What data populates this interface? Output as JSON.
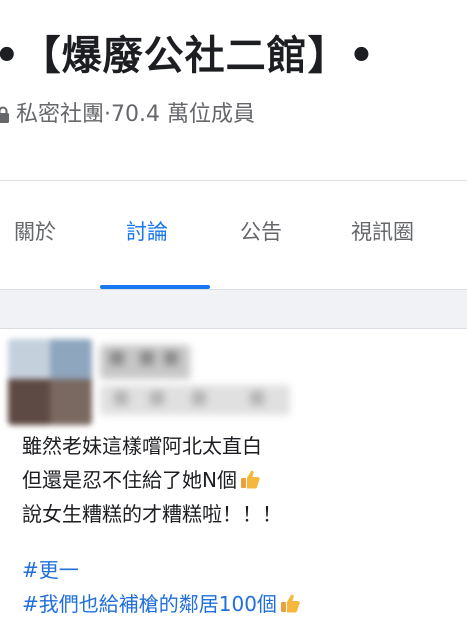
{
  "group": {
    "title": "•【爆廢公社二館】•",
    "privacy_label": "私密社團",
    "separator": " · ",
    "members": "70.4 萬位成員"
  },
  "tabs": [
    {
      "label": "關於",
      "active": false
    },
    {
      "label": "討論",
      "active": true
    },
    {
      "label": "公告",
      "active": false
    },
    {
      "label": "視訊圈",
      "active": false
    }
  ],
  "post": {
    "lines": [
      "雖然老妹這樣嚐阿北太直白",
      "但還是忍不住給了她N個",
      "說女生糟糕的才糟糕啦！！！"
    ],
    "hashtags": [
      "#更一",
      "#我們也給補槍的鄰居100個"
    ]
  },
  "colors": {
    "accent": "#1877f2",
    "hashtag": "#216fdb",
    "muted": "#65676b",
    "gap": "#f0f2f5"
  }
}
